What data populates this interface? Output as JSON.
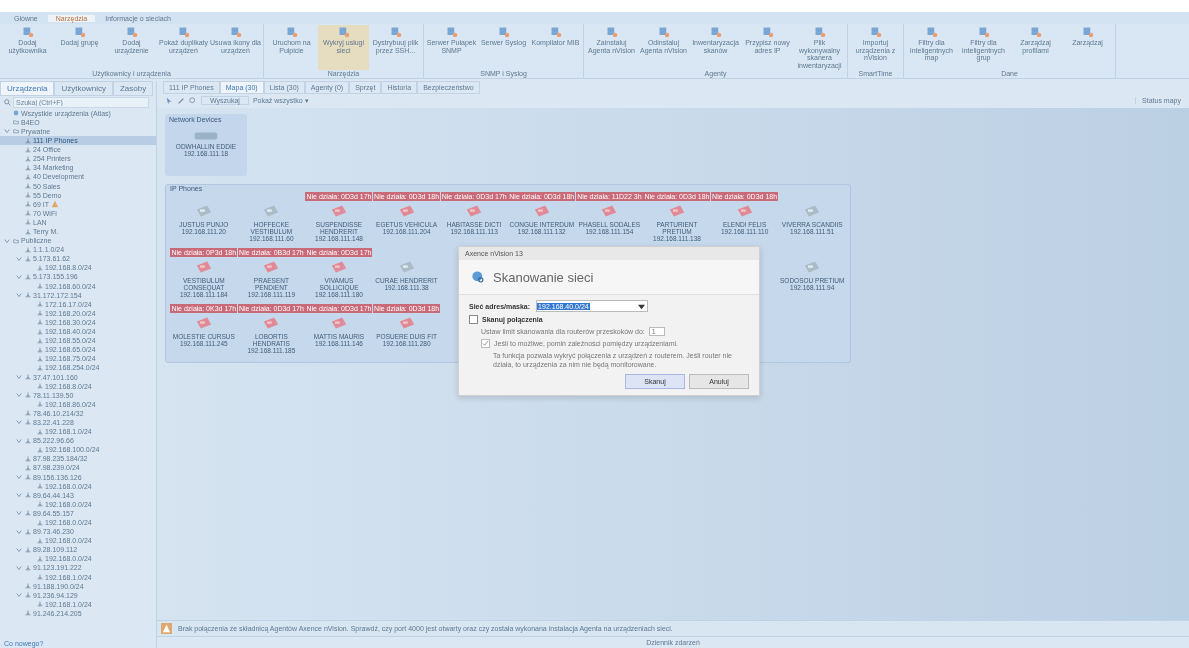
{
  "ribbon": {
    "tabs": [
      {
        "label": "Główne",
        "selected": false
      },
      {
        "label": "Narzędzia",
        "selected": true
      },
      {
        "label": "Informacje o sieciach",
        "selected": false
      }
    ],
    "groups": [
      {
        "label": "Użytkownicy i urządzenia",
        "buttons": [
          {
            "label": "Dodaj użytkownika",
            "selected": false
          },
          {
            "label": "Dodaj grupę",
            "selected": false
          },
          {
            "label": "Dodaj urządzenie",
            "selected": false
          },
          {
            "label": "Pokaż duplikaty urządzeń",
            "selected": false
          },
          {
            "label": "Usuwa ikony dla urządzeń",
            "selected": false
          }
        ]
      },
      {
        "label": "Narzędzia",
        "buttons": [
          {
            "label": "Uruchom na Pulpicie",
            "selected": false
          },
          {
            "label": "Wykryj usługi sieci",
            "selected": true
          },
          {
            "label": "Dystrybuuj plik przez SSH...",
            "selected": false
          }
        ]
      },
      {
        "label": "SNMP i Syslog",
        "buttons": [
          {
            "label": "Serwer Pułapek SNMP",
            "selected": false
          },
          {
            "label": "Serwer Syslog",
            "selected": false
          },
          {
            "label": "Kompilator MIB",
            "selected": false
          }
        ]
      },
      {
        "label": "Agenty",
        "buttons": [
          {
            "label": "Zainstaluj Agenta nVision",
            "selected": false
          },
          {
            "label": "Odinstaluj Agenta nVision",
            "selected": false
          },
          {
            "label": "Inwentaryzacja skanów",
            "selected": false
          },
          {
            "label": "Przypisz nowy adres IP",
            "selected": false
          },
          {
            "label": "Plik wykonywalny skanera inwentaryzacji",
            "selected": false
          }
        ]
      },
      {
        "label": "SmartTime",
        "buttons": [
          {
            "label": "Importuj urządzenia z nVision",
            "selected": false
          }
        ]
      },
      {
        "label": "Dane",
        "buttons": [
          {
            "label": "Filtry dla inteligentnych map",
            "selected": false
          },
          {
            "label": "Filtry dla inteligentnych grup",
            "selected": false
          },
          {
            "label": "Zarządzaj profilami",
            "selected": false
          },
          {
            "label": "Zarządzaj",
            "selected": false
          }
        ]
      }
    ]
  },
  "sidebar": {
    "tabs": [
      {
        "label": "Urządzenia",
        "selected": true
      },
      {
        "label": "Użytkownicy",
        "selected": false
      },
      {
        "label": "Zasoby",
        "selected": false
      }
    ],
    "search": {
      "placeholder": "Szukaj (Ctrl+F)"
    },
    "tree": [
      {
        "label": "Wszystkie urządzenia (Atlas)",
        "kind": "all",
        "selected": false
      },
      {
        "label": "B4EO",
        "kind": "folder",
        "selected": false
      },
      {
        "label": "Prywatne",
        "kind": "folder",
        "selected": false,
        "expanded": true,
        "children": [
          {
            "label": "111 IP Phones",
            "kind": "net",
            "selected": true
          },
          {
            "label": "24 Office",
            "kind": "net",
            "selected": false
          },
          {
            "label": "254 Printers",
            "kind": "net",
            "selected": false
          },
          {
            "label": "34 Marketing",
            "kind": "net",
            "selected": false
          },
          {
            "label": "40 Development",
            "kind": "net",
            "selected": false
          },
          {
            "label": "50 Sales",
            "kind": "net",
            "selected": false
          },
          {
            "label": "55 Demo",
            "kind": "net",
            "selected": false
          },
          {
            "label": "69 IT",
            "kind": "net",
            "selected": false,
            "warning": true
          },
          {
            "label": "70 WiFi",
            "kind": "net",
            "selected": false
          },
          {
            "label": "LAN",
            "kind": "net",
            "selected": false
          },
          {
            "label": "Terry M.",
            "kind": "net",
            "selected": false
          }
        ]
      },
      {
        "label": "Publiczne",
        "kind": "folder",
        "selected": false,
        "expanded": true,
        "children": [
          {
            "label": "1.1.1.0/24",
            "kind": "net",
            "selected": false
          },
          {
            "label": "5.173.61.62",
            "kind": "net",
            "selected": false,
            "expanded": true,
            "children": [
              {
                "label": "192.168.8.0/24",
                "kind": "net",
                "selected": false
              }
            ]
          },
          {
            "label": "5.173.155.196",
            "kind": "net",
            "selected": false,
            "expanded": true,
            "children": [
              {
                "label": "192.168.60.0/24",
                "kind": "net",
                "selected": false
              }
            ]
          },
          {
            "label": "31.172.172.154",
            "kind": "net",
            "selected": false,
            "expanded": true,
            "children": [
              {
                "label": "172.16.17.0/24",
                "kind": "net",
                "selected": false
              },
              {
                "label": "192.168.20.0/24",
                "kind": "net",
                "selected": false
              },
              {
                "label": "192.168.30.0/24",
                "kind": "net",
                "selected": false
              },
              {
                "label": "192.168.40.0/24",
                "kind": "net",
                "selected": false
              },
              {
                "label": "192.168.55.0/24",
                "kind": "net",
                "selected": false
              },
              {
                "label": "192.168.65.0/24",
                "kind": "net",
                "selected": false
              },
              {
                "label": "192.168.75.0/24",
                "kind": "net",
                "selected": false
              },
              {
                "label": "192.168.254.0/24",
                "kind": "net",
                "selected": false
              }
            ]
          },
          {
            "label": "37.47.101.160",
            "kind": "net",
            "selected": false,
            "expanded": true,
            "children": [
              {
                "label": "192.168.8.0/24",
                "kind": "net",
                "selected": false
              }
            ]
          },
          {
            "label": "78.11.139.50",
            "kind": "net",
            "selected": false,
            "expanded": true,
            "children": [
              {
                "label": "192.168.86.0/24",
                "kind": "net",
                "selected": false
              }
            ]
          },
          {
            "label": "78.46.10.214/32",
            "kind": "net",
            "selected": false
          },
          {
            "label": "83.22.41.228",
            "kind": "net",
            "selected": false,
            "expanded": true,
            "children": [
              {
                "label": "192.168.1.0/24",
                "kind": "net",
                "selected": false
              }
            ]
          },
          {
            "label": "85.222.96.66",
            "kind": "net",
            "selected": false,
            "expanded": true,
            "children": [
              {
                "label": "192.168.100.0/24",
                "kind": "net",
                "selected": false
              }
            ]
          },
          {
            "label": "87.98.235.184/32",
            "kind": "net",
            "selected": false
          },
          {
            "label": "87.98.239.0/24",
            "kind": "net",
            "selected": false
          },
          {
            "label": "89.156.136.126",
            "kind": "net",
            "selected": false,
            "expanded": true,
            "children": [
              {
                "label": "192.168.0.0/24",
                "kind": "net",
                "selected": false
              }
            ]
          },
          {
            "label": "89.64.44.143",
            "kind": "net",
            "selected": false,
            "expanded": true,
            "children": [
              {
                "label": "192.168.0.0/24",
                "kind": "net",
                "selected": false
              }
            ]
          },
          {
            "label": "89.64.55.157",
            "kind": "net",
            "selected": false,
            "expanded": true,
            "children": [
              {
                "label": "192.168.0.0/24",
                "kind": "net",
                "selected": false
              }
            ]
          },
          {
            "label": "89.73.46.230",
            "kind": "net",
            "selected": false,
            "expanded": true,
            "children": [
              {
                "label": "192.168.0.0/24",
                "kind": "net",
                "selected": false
              }
            ]
          },
          {
            "label": "89.28.109.112",
            "kind": "net",
            "selected": false,
            "expanded": true,
            "children": [
              {
                "label": "192.168.0.0/24",
                "kind": "net",
                "selected": false
              }
            ]
          },
          {
            "label": "91.123.191.222",
            "kind": "net",
            "selected": false,
            "expanded": true,
            "children": [
              {
                "label": "192.168.1.0/24",
                "kind": "net",
                "selected": false
              }
            ]
          },
          {
            "label": "91.188.190.0/24",
            "kind": "net",
            "selected": false
          },
          {
            "label": "91.236.94.129",
            "kind": "net",
            "selected": false,
            "expanded": true,
            "children": [
              {
                "label": "192.168.1.0/24",
                "kind": "net",
                "selected": false
              }
            ]
          },
          {
            "label": "91.246.214.205",
            "kind": "net",
            "selected": false
          }
        ]
      }
    ],
    "footer": "Co nowego?"
  },
  "main": {
    "tabs": [
      {
        "label": "111 IP Phones",
        "selected": false
      },
      {
        "label": "Mapa (30)",
        "selected": true
      },
      {
        "label": "Lista (30)",
        "selected": false
      },
      {
        "label": "Agenty (0)",
        "selected": false
      },
      {
        "label": "Sprzęt",
        "selected": false
      },
      {
        "label": "Historia",
        "selected": false
      },
      {
        "label": "Bezpieczeństwo",
        "selected": false
      }
    ],
    "toolbar": {
      "zoom_field": "Wyszukaj",
      "filter": "Pokaż wszystko ▾"
    },
    "map_status": "Status mapy",
    "network_devices": {
      "title": "Network Devices",
      "device": {
        "name": "ODWHALLIN EDDIE",
        "ip": "192.168.111.18"
      }
    },
    "phones": {
      "title": "IP Phones",
      "rows": [
        [
          {
            "name": "JUSTUS PUNJO",
            "ip": "192.168.111.20",
            "down": false
          },
          {
            "name": "HOFFECKE VESTIBULUM",
            "ip": "192.168.111.60",
            "down": false
          },
          {
            "name": "SUSPENDISSE HENDRERIT",
            "ip": "192.168.111.148",
            "down": true,
            "badge": "Nie działa: 0D3d 17h"
          },
          {
            "name": "EGETUS VEHICULA",
            "ip": "192.168.111.204",
            "down": true,
            "badge": "Nie działa: 0D3d 18h"
          },
          {
            "name": "HABITASSE DICTI",
            "ip": "192.168.111.113",
            "down": true,
            "badge": "Nie działa: 0D3d 17h"
          },
          {
            "name": "CONGUE INTERDUM",
            "ip": "192.168.111.132",
            "down": true,
            "badge": "Nie działa: 0D3d 18h"
          },
          {
            "name": "PHASELL SODALES",
            "ip": "192.168.111.154",
            "down": true,
            "badge": "Nie działa: 11D22 3h"
          },
          {
            "name": "PARTURIENT PRETIUM",
            "ip": "192.168.111.138",
            "down": true,
            "badge": "Nie działa: 0D3d 18h"
          },
          {
            "name": "ELENDI FELIS",
            "ip": "192.168.111.110",
            "down": true,
            "badge": "Nie działa: 0D3d 18h"
          },
          {
            "name": "VIVERRA SCANDIIS",
            "ip": "192.168.111.51",
            "down": false
          }
        ],
        [
          {
            "name": "VESTIBULUM CONSEQUAT",
            "ip": "192.168.111.184",
            "down": true,
            "badge": "Nie działa: 0P3d 18h"
          },
          {
            "name": "PRAESENT PENDIENT",
            "ip": "192.168.111.119",
            "down": true,
            "badge": "Nie działa: 0B3d 17h"
          },
          {
            "name": "VIVAMUS SOLLICIQUE",
            "ip": "192.168.111.180",
            "down": true,
            "badge": "Nie działa: 0D3d 17h"
          },
          {
            "name": "CURAE HENDRERIT",
            "ip": "192.168.111.38",
            "down": false
          },
          null,
          null,
          null,
          null,
          null,
          {
            "name": "SODOSOU PRETIUM",
            "ip": "192.168.111.94",
            "down": false
          }
        ],
        [
          {
            "name": "MOLESTIE CURSUS",
            "ip": "192.168.111.245",
            "down": true,
            "badge": "Nie działa: 0K3d 17h"
          },
          {
            "name": "LOBORTIS HENDRATIS",
            "ip": "192.168.111.185",
            "down": true,
            "badge": "Nie działa: 0D3d 17h"
          },
          {
            "name": "MATTIS MAURIS",
            "ip": "192.168.111.146",
            "down": true,
            "badge": "Nie działa: 0D3d 17h"
          },
          {
            "name": "POSUERE DUIS FIT",
            "ip": "192.168.111.280",
            "down": true,
            "badge": "Nie działa: 0D3d 18h"
          },
          null,
          null,
          null,
          null,
          null,
          null
        ]
      ]
    },
    "notice": "Brak połączenia ze składnicą Agentów Axence nVision. Sprawdź, czy port 4000 jest otwarty oraz czy została wykonana instalacja Agenta na urządzeniach sieci.",
    "log_title": "Dziennik zdarzeń"
  },
  "dialog": {
    "title": "Axence nVision 13",
    "heading": "Skanowanie sieci",
    "network_label": "Sieć adres/maska:",
    "network_value": "192.168.40.0/24",
    "scan_links": {
      "label": "Skanuj połączenia",
      "checked": false
    },
    "hop_label": "Ustaw limit skanowania dla routerów przeskoków do:",
    "hop_value": "1",
    "skip": {
      "label": "Jeśli to możliwe, pomiń zależności pomiędzy urządzeniami.",
      "checked": true
    },
    "note": "Ta funkcja pozwala wykryć połączenia z urządzeń z routerem. Jeśli router nie działa, to urządzenia za nim nie będą monitorowane.",
    "buttons": [
      {
        "label": "Skanuj",
        "kind": "primary"
      },
      {
        "label": "Anuluj",
        "kind": "secondary"
      }
    ]
  }
}
